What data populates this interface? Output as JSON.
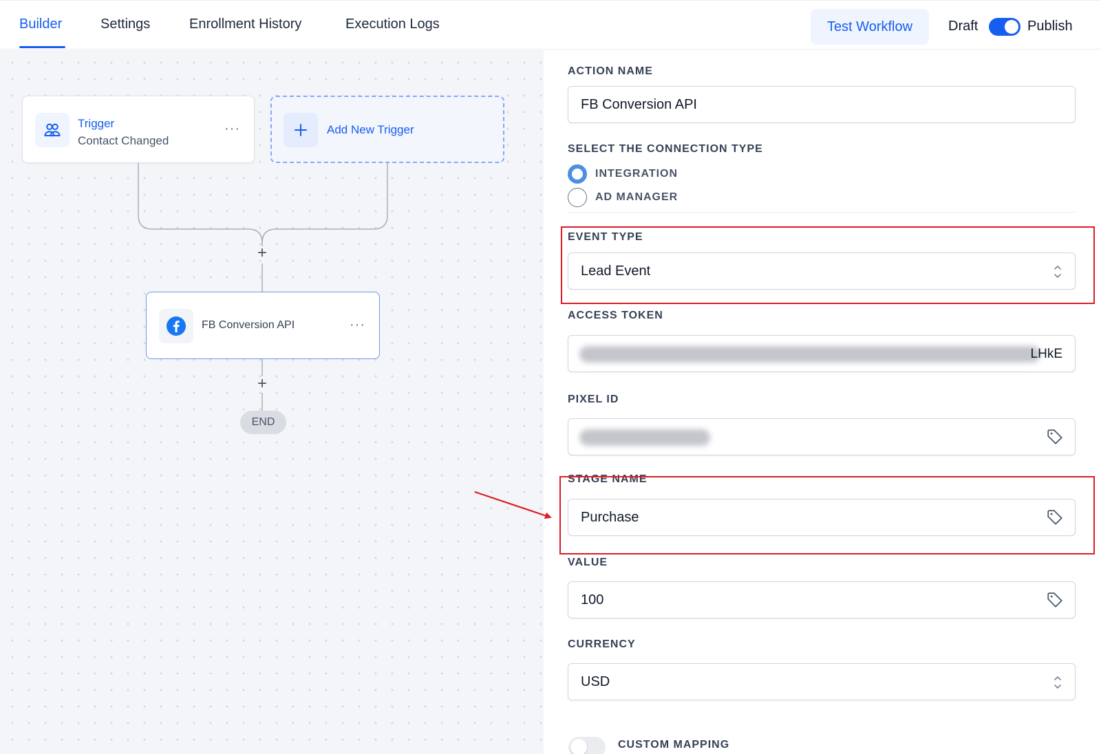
{
  "tabs": [
    {
      "label": "Builder",
      "active": true
    },
    {
      "label": "Settings",
      "active": false
    },
    {
      "label": "Enrollment History",
      "active": false
    },
    {
      "label": "Execution Logs",
      "active": false
    }
  ],
  "header": {
    "test_button": "Test Workflow",
    "draft_label": "Draft",
    "publish_label": "Publish",
    "publish_toggle_on": true
  },
  "canvas": {
    "trigger": {
      "title": "Trigger",
      "subtitle": "Contact Changed",
      "menu": "···",
      "icon": "users-icon"
    },
    "add_trigger": {
      "label": "Add New Trigger",
      "icon": "plus-icon"
    },
    "action": {
      "label": "FB Conversion API",
      "menu": "···",
      "icon": "facebook-icon"
    },
    "add_step_symbol": "+",
    "end_label": "END"
  },
  "panel": {
    "action_name": {
      "label": "ACTION NAME",
      "value": "FB Conversion API"
    },
    "connection_type": {
      "label": "SELECT THE CONNECTION TYPE",
      "options": [
        {
          "label": "INTEGRATION",
          "checked": true
        },
        {
          "label": "AD MANAGER",
          "checked": false
        }
      ]
    },
    "event_type": {
      "label": "EVENT TYPE",
      "value": "Lead Event"
    },
    "access_token": {
      "label": "ACCESS TOKEN",
      "visible_suffix": "LHkE"
    },
    "pixel_id": {
      "label": "PIXEL ID"
    },
    "stage_name": {
      "label": "STAGE NAME",
      "value": "Purchase"
    },
    "value": {
      "label": "VALUE",
      "value": "100"
    },
    "currency": {
      "label": "CURRENCY",
      "value": "USD"
    },
    "custom_mapping": {
      "label": "CUSTOM MAPPING",
      "enabled": false
    }
  },
  "colors": {
    "accent": "#155eef",
    "highlight": "#dc1c26",
    "radio_checked": "#4b90e2"
  }
}
